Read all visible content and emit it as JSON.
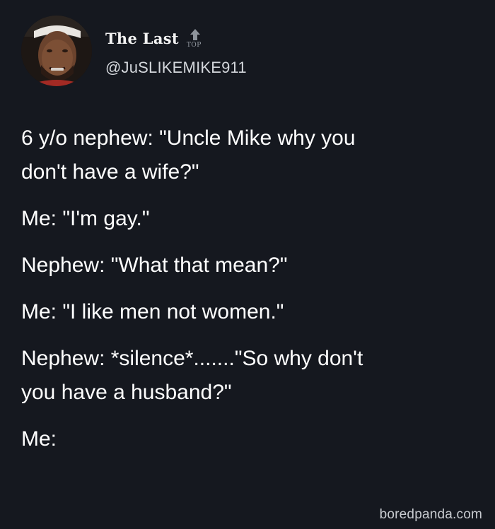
{
  "author": {
    "display_name": "The Last",
    "badge_text": "TOP",
    "badge_icon": "up-arrow-icon",
    "handle": "@JuSLIKEMIKE911"
  },
  "tweet": {
    "lines": [
      "6 y/o nephew: \"Uncle Mike why you",
      "don't have a wife?\"",
      "Me: \"I'm gay.\"",
      "Nephew: \"What that mean?\"",
      "Me: \"I like men not women.\"",
      "Nephew: *silence*.......\"So why don't",
      "you have a husband?\"",
      "Me:"
    ]
  },
  "watermark": "boredpanda.com",
  "colors": {
    "background": "#15181f",
    "text": "#ffffff",
    "handle": "#d4d7dc"
  }
}
